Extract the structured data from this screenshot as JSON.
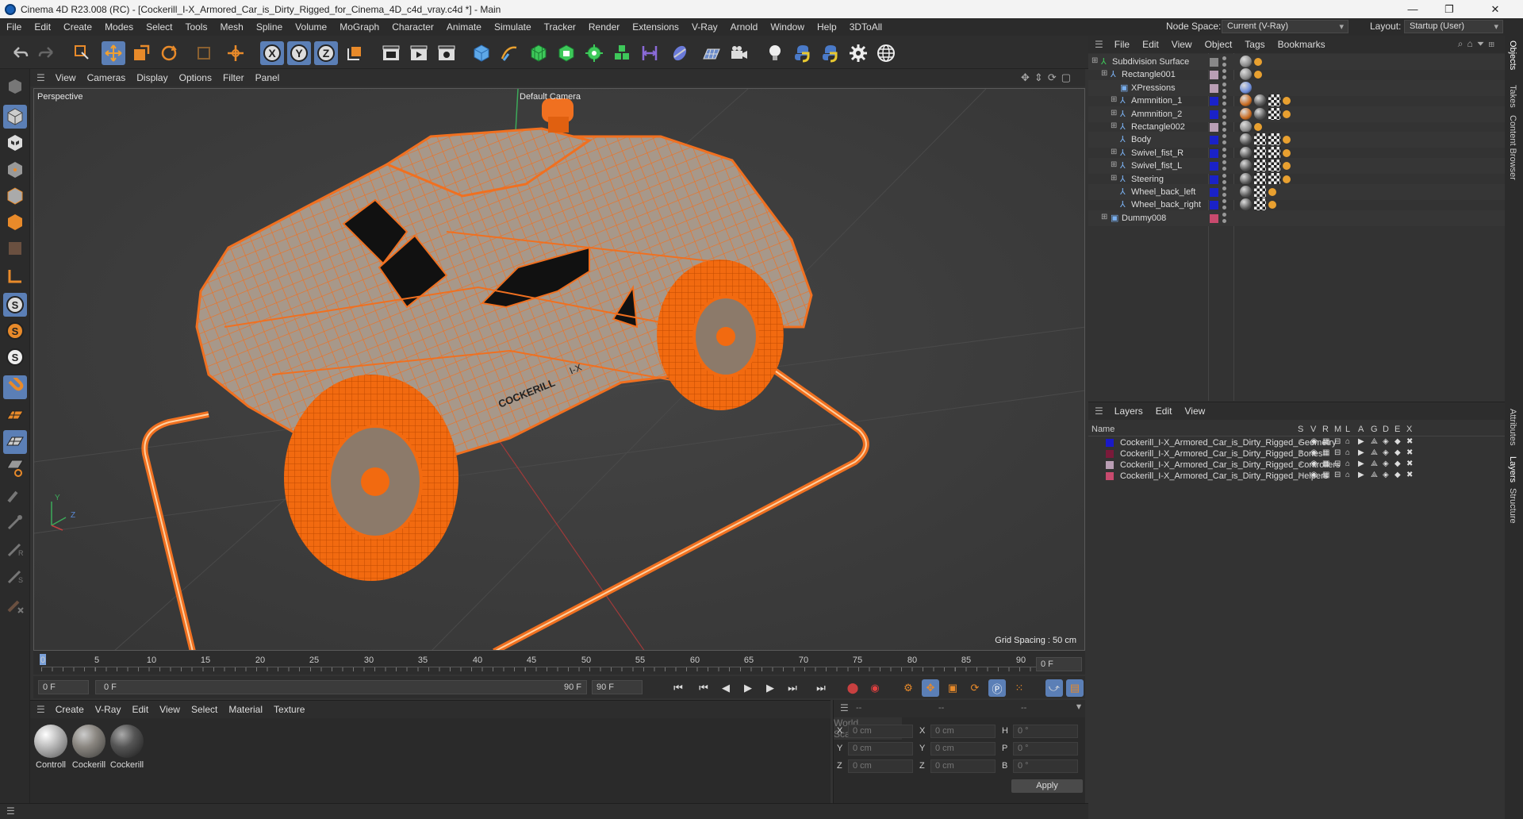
{
  "window": {
    "title": "Cinema 4D R23.008 (RC) - [Cockerill_I-X_Armored_Car_is_Dirty_Rigged_for_Cinema_4D_c4d_vray.c4d *] - Main",
    "minimize": "—",
    "maximize": "❐",
    "close": "✕"
  },
  "menubar": {
    "items": [
      "File",
      "Edit",
      "Create",
      "Modes",
      "Select",
      "Tools",
      "Mesh",
      "Spline",
      "Volume",
      "MoGraph",
      "Character",
      "Animate",
      "Simulate",
      "Tracker",
      "Render",
      "Extensions",
      "V-Ray",
      "Arnold",
      "Window",
      "Help",
      "3DToAll"
    ],
    "node_space_label": "Node Space:",
    "node_space_value": "Current (V-Ray)",
    "layout_label": "Layout:",
    "layout_value": "Startup (User)"
  },
  "viewport": {
    "menu": [
      "View",
      "Cameras",
      "Display",
      "Options",
      "Filter",
      "Panel"
    ],
    "view_name": "Perspective",
    "camera": "Default Camera",
    "grid_spacing": "Grid Spacing : 50 cm",
    "car_badge": "COCKERILL",
    "car_badge2": "I-X",
    "axis_y": "Y",
    "axis_z": "Z"
  },
  "timeline": {
    "ticks": [
      "0",
      "5",
      "10",
      "15",
      "20",
      "25",
      "30",
      "35",
      "40",
      "45",
      "50",
      "55",
      "60",
      "65",
      "70",
      "75",
      "80",
      "85",
      "90"
    ],
    "current_frame_field": "0 F"
  },
  "transport": {
    "start_field": "0 F",
    "slider_start": "0 F",
    "slider_end": "90 F",
    "end_field": "90 F"
  },
  "material_manager": {
    "menu": [
      "Create",
      "V-Ray",
      "Edit",
      "View",
      "Select",
      "Material",
      "Texture"
    ],
    "materials": [
      {
        "label": "Controll",
        "color": "#d9d9d9"
      },
      {
        "label": "Cockerill",
        "color": "#7a7a72"
      },
      {
        "label": "Cockerill",
        "color": "#555"
      }
    ]
  },
  "coordinates": {
    "header1": "--",
    "header2": "--",
    "header3": "--",
    "rows": [
      {
        "a": "X",
        "av": "0 cm",
        "b": "X",
        "bv": "0 cm",
        "c": "H",
        "cv": "0 °"
      },
      {
        "a": "Y",
        "av": "0 cm",
        "b": "Y",
        "bv": "0 cm",
        "c": "P",
        "cv": "0 °"
      },
      {
        "a": "Z",
        "av": "0 cm",
        "b": "Z",
        "bv": "0 cm",
        "c": "B",
        "cv": "0 °"
      }
    ],
    "mode1": "World",
    "mode2": "Scale",
    "apply": "Apply"
  },
  "object_manager": {
    "menu": [
      "File",
      "Edit",
      "View",
      "Object",
      "Tags",
      "Bookmarks"
    ],
    "objects": [
      {
        "name": "Subdivision Surface",
        "indent": 0,
        "color": "#888",
        "icon": "subdivision-icon"
      },
      {
        "name": "Rectangle001",
        "indent": 1,
        "color": "#b99eb4",
        "icon": "bone-icon"
      },
      {
        "name": "XPressions",
        "indent": 2,
        "color": "#b99eb4",
        "icon": "null-icon"
      },
      {
        "name": "Ammnition_1",
        "indent": 2,
        "color": "#1a22c8",
        "icon": "bone-icon"
      },
      {
        "name": "Ammnition_2",
        "indent": 2,
        "color": "#1a22c8",
        "icon": "bone-icon"
      },
      {
        "name": "Rectangle002",
        "indent": 2,
        "color": "#b99eb4",
        "icon": "bone-icon"
      },
      {
        "name": "Body",
        "indent": 2,
        "color": "#1a22c8",
        "icon": "bone-icon"
      },
      {
        "name": "Swivel_fist_R",
        "indent": 2,
        "color": "#1a22c8",
        "icon": "bone-icon"
      },
      {
        "name": "Swivel_fist_L",
        "indent": 2,
        "color": "#1a22c8",
        "icon": "bone-icon"
      },
      {
        "name": "Steering",
        "indent": 2,
        "color": "#1a22c8",
        "icon": "bone-icon"
      },
      {
        "name": "Wheel_back_left",
        "indent": 2,
        "color": "#1a22c8",
        "icon": "bone-icon"
      },
      {
        "name": "Wheel_back_right",
        "indent": 2,
        "color": "#1a22c8",
        "icon": "bone-icon"
      },
      {
        "name": "Dummy008",
        "indent": 1,
        "color": "#c84a6e",
        "icon": "null-icon"
      }
    ]
  },
  "layer_manager": {
    "menu": [
      "Layers",
      "Edit",
      "View"
    ],
    "columns": [
      "Name",
      "S",
      "V",
      "R",
      "M",
      "L",
      "A",
      "G",
      "D",
      "E",
      "X"
    ],
    "layers": [
      {
        "name": "Cockerill_I-X_Armored_Car_is_Dirty_Rigged_Geometry",
        "color": "#1a1ac8"
      },
      {
        "name": "Cockerill_I-X_Armored_Car_is_Dirty_Rigged_Bones",
        "color": "#7a1a3a"
      },
      {
        "name": "Cockerill_I-X_Armored_Car_is_Dirty_Rigged_Controllers",
        "color": "#b99eb4"
      },
      {
        "name": "Cockerill_I-X_Armored_Car_is_Dirty_Rigged_Helpers",
        "color": "#c84a6e"
      }
    ]
  },
  "right_tabs": [
    "Objects",
    "Takes",
    "Content Browser",
    "Attributes",
    "Layers",
    "Structure"
  ]
}
